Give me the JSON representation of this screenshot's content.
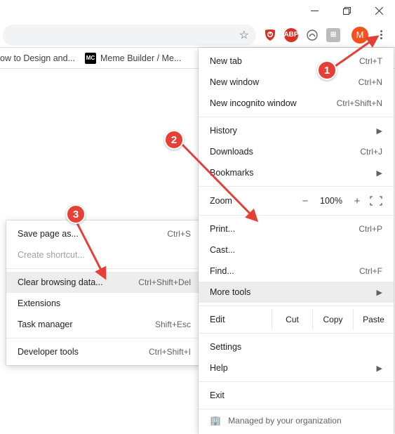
{
  "bookmarks": {
    "item1": {
      "label": "ow to Design and..."
    },
    "item2": {
      "label": "Meme Builder / Me...",
      "favicon_text": "MC"
    }
  },
  "avatar": {
    "initial": "M"
  },
  "main_menu": {
    "new_tab": {
      "label": "New tab",
      "shortcut": "Ctrl+T"
    },
    "new_window": {
      "label": "New window",
      "shortcut": "Ctrl+N"
    },
    "new_incognito": {
      "label": "New incognito window",
      "shortcut": "Ctrl+Shift+N"
    },
    "history": {
      "label": "History"
    },
    "downloads": {
      "label": "Downloads",
      "shortcut": "Ctrl+J"
    },
    "bookmarks": {
      "label": "Bookmarks"
    },
    "zoom": {
      "label": "Zoom",
      "value": "100%",
      "minus": "−",
      "plus": "+"
    },
    "print": {
      "label": "Print...",
      "shortcut": "Ctrl+P"
    },
    "cast": {
      "label": "Cast..."
    },
    "find": {
      "label": "Find...",
      "shortcut": "Ctrl+F"
    },
    "more_tools": {
      "label": "More tools"
    },
    "edit": {
      "label": "Edit",
      "cut": "Cut",
      "copy": "Copy",
      "paste": "Paste"
    },
    "settings": {
      "label": "Settings"
    },
    "help": {
      "label": "Help"
    },
    "exit": {
      "label": "Exit"
    },
    "managed": {
      "label": "Managed by your organization"
    }
  },
  "submenu": {
    "save_page": {
      "label": "Save page as...",
      "shortcut": "Ctrl+S"
    },
    "create_shortcut": {
      "label": "Create shortcut..."
    },
    "clear_data": {
      "label": "Clear browsing data...",
      "shortcut": "Ctrl+Shift+Del"
    },
    "extensions": {
      "label": "Extensions"
    },
    "task_manager": {
      "label": "Task manager",
      "shortcut": "Shift+Esc"
    },
    "devtools": {
      "label": "Developer tools",
      "shortcut": "Ctrl+Shift+I"
    }
  },
  "callouts": {
    "c1": "1",
    "c2": "2",
    "c3": "3"
  }
}
